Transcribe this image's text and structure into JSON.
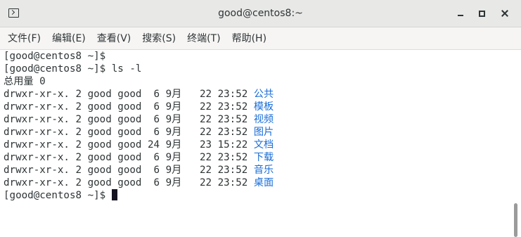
{
  "window": {
    "title": "good@centos8:~",
    "buttons": [
      "minimize-icon",
      "maximize-icon",
      "close-icon"
    ]
  },
  "menu": {
    "items": [
      "文件(F)",
      "编辑(E)",
      "查看(V)",
      "搜索(S)",
      "终端(T)",
      "帮助(H)"
    ]
  },
  "terminal": {
    "prompt": "[good@centos8 ~]$ ",
    "command": "ls -l",
    "total": "总用量 0",
    "entries": [
      {
        "prefix": "drwxr-xr-x. 2 good good  6 9月   22 23:52 ",
        "name": "公共"
      },
      {
        "prefix": "drwxr-xr-x. 2 good good  6 9月   22 23:52 ",
        "name": "模板"
      },
      {
        "prefix": "drwxr-xr-x. 2 good good  6 9月   22 23:52 ",
        "name": "视频"
      },
      {
        "prefix": "drwxr-xr-x. 2 good good  6 9月   22 23:52 ",
        "name": "图片"
      },
      {
        "prefix": "drwxr-xr-x. 2 good good 24 9月   23 15:22 ",
        "name": "文档"
      },
      {
        "prefix": "drwxr-xr-x. 2 good good  6 9月   22 23:52 ",
        "name": "下载"
      },
      {
        "prefix": "drwxr-xr-x. 2 good good  6 9月   22 23:52 ",
        "name": "音乐"
      },
      {
        "prefix": "drwxr-xr-x. 2 good good  6 9月   22 23:52 ",
        "name": "桌面"
      }
    ],
    "colors": {
      "directory": "#1a6ed8",
      "text": "#2e3436"
    }
  }
}
